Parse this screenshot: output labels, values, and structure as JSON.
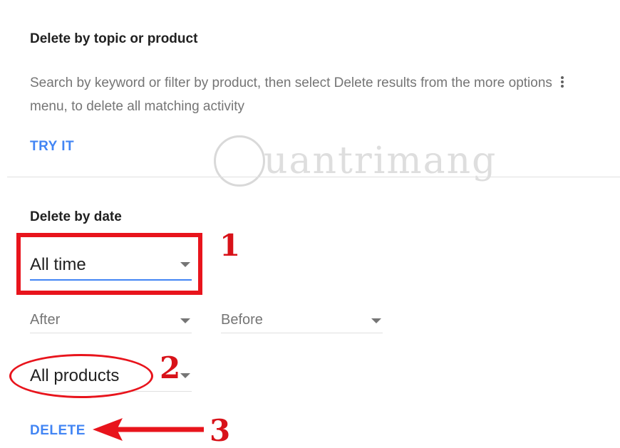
{
  "topic_section": {
    "title": "Delete by topic or product",
    "description_before_icon": "Search by keyword or filter by product, then select Delete results from the more options",
    "more_options_icon": "more-vert-icon",
    "description_after_icon": "menu, to delete all matching activity",
    "try_it_label": "TRY IT"
  },
  "date_section": {
    "title": "Delete by date",
    "range_select": {
      "value": "All time"
    },
    "after_select": {
      "placeholder": "After"
    },
    "before_select": {
      "placeholder": "Before"
    },
    "products_select": {
      "value": "All products"
    },
    "delete_label": "DELETE"
  },
  "annotations": {
    "step1": "1",
    "step2": "2",
    "step3": "3",
    "color": "#e8141c"
  },
  "watermark": {
    "text": "uantrimang"
  },
  "colors": {
    "accent": "#4285f4",
    "muted_text": "#757575",
    "divider": "#e0e0e0"
  }
}
